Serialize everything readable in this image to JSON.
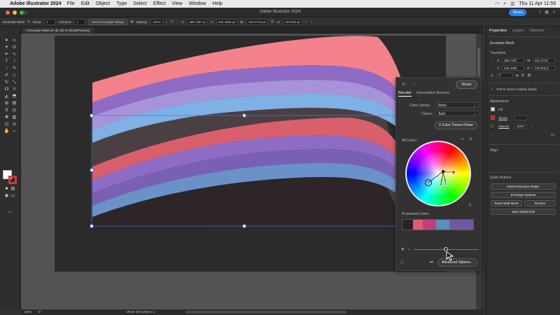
{
  "menubar": {
    "app": "Adobe Illustrator 2024",
    "items": [
      "File",
      "Edit",
      "Object",
      "Type",
      "Select",
      "Effect",
      "View",
      "Window",
      "Help"
    ],
    "clock": "Thu 11 Apr  11:59"
  },
  "window": {
    "title": "Adobe Illustrator 2024",
    "share_label": "Share"
  },
  "controlbar": {
    "selection": "Envelope Mesh",
    "rows_label": "Rows:",
    "rows_value": "1",
    "columns_label": "Columns:",
    "columns_value": "1",
    "reset_button": "Reset Envelope Shape",
    "opacity_label": "Opacity:",
    "opacity_value": "100%",
    "x_label": "X:",
    "x_value": "386.7287 pt",
    "y_label": "Y:",
    "y_value": "404.4385 pt",
    "w_label": "W:",
    "w_value": "622.2719 pt",
    "h_label": "H:",
    "h_value": "223.502 pt"
  },
  "document_tab": {
    "label": "Envelope Mesh.ai* @ 150 % (RGB/Preview)",
    "close": "×"
  },
  "statusbar": {
    "zoom": "150%",
    "rotation": "0°",
    "profile": "sRGB IEC61966-2.1"
  },
  "recolor": {
    "reset_label": "Reset",
    "tab_recolor": "Recolor",
    "tab_generative": "Generative Recolor",
    "library_label": "Color Library:",
    "library_value": "None",
    "colors_label": "Colors:",
    "colors_value": "Auto",
    "theme_picker": "Color Theme Picker",
    "all_colors": "All Colors",
    "prominent_colors": "Prominent Colors",
    "prominent_swatches": [
      "#2a2226",
      "#d9606a",
      "#c83c78",
      "#5b8fc0",
      "#7257a3"
    ],
    "advanced_options": "Advanced Options...",
    "saturation_level": 0.5
  },
  "properties": {
    "tabs": [
      "Properties",
      "Layers",
      "Libraries"
    ],
    "selection": "Envelope Mesh",
    "transform": "Transform",
    "x_label": "X:",
    "x_value": "386.7287",
    "y_label": "Y:",
    "y_value": "404.4385",
    "w_label": "W:",
    "w_value": "622.2719",
    "h_label": "H:",
    "h_value": "223.502 p",
    "angle_value": "0°",
    "text_to_vector": "Text to Vector Graphic (Beta)",
    "appearance": "Appearance",
    "fill_label": "Fill",
    "stroke_label": "Stroke",
    "opacity_label": "Opacity",
    "opacity_value": "100%",
    "align": "Align",
    "quick_actions": "Quick Actions",
    "reset_envelope": "Reset Envelope Shape",
    "envelope_options": "Envelope Options",
    "reset_with_mesh": "Reset With Mesh",
    "recolor_btn": "Recolor",
    "start_global_edit": "Start Global Edit"
  },
  "colors": {
    "accent": "#2680eb",
    "stroke_red": "#d23a3a",
    "band_pink": "#f4828c",
    "band_purple": "#8e6cc6",
    "band_lavender": "#a794d8",
    "band_blue": "#7fb0e6"
  }
}
